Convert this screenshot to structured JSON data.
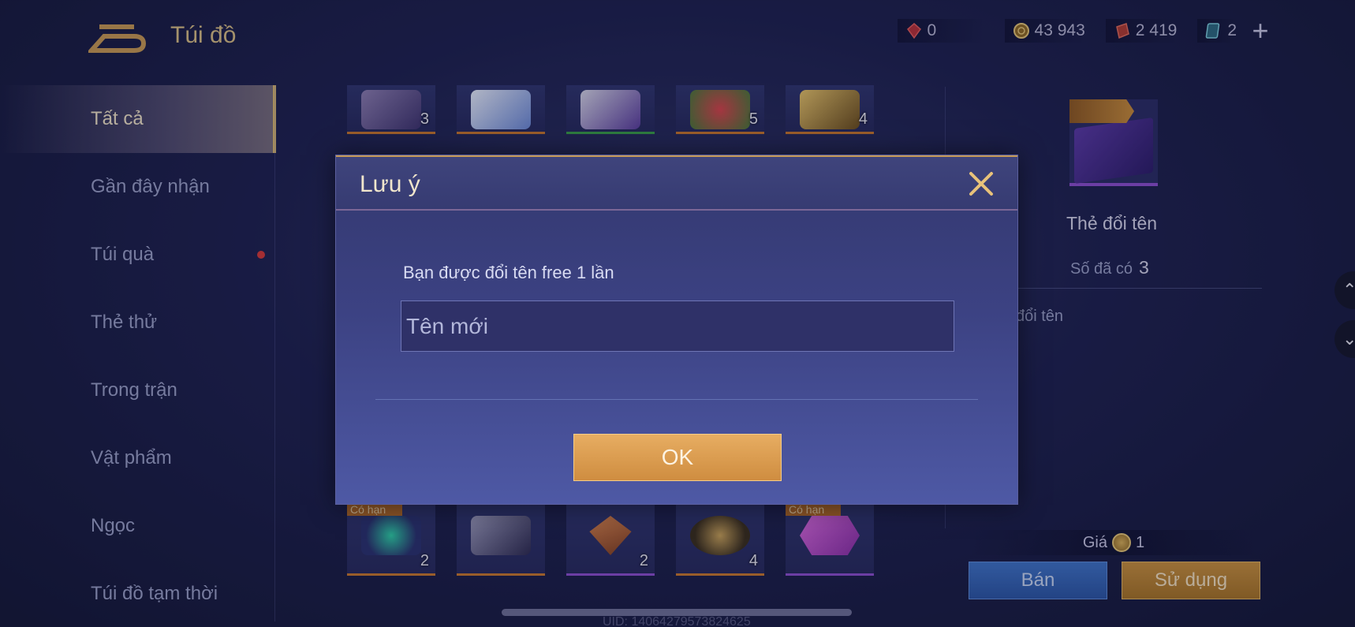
{
  "header": {
    "title": "Túi đồ",
    "currencies": [
      {
        "icon": "red-gem-icon",
        "value": "0",
        "color": "#d63a3a"
      },
      {
        "icon": "gold-coin-icon",
        "value": "43 943",
        "color": "#d9b15a"
      },
      {
        "icon": "red-voucher-icon",
        "value": "2 419",
        "color": "#c9433a"
      },
      {
        "icon": "blue-card-icon",
        "value": "2",
        "color": "#5fb2c9"
      }
    ],
    "add_label": "+"
  },
  "sidebar": {
    "items": [
      {
        "label": "Tất cả",
        "active": true
      },
      {
        "label": "Gần đây nhận"
      },
      {
        "label": "Túi quà",
        "badge": true
      },
      {
        "label": "Thẻ thử"
      },
      {
        "label": "Trong trận"
      },
      {
        "label": "Vật phẩm"
      },
      {
        "label": "Ngọc"
      },
      {
        "label": "Túi đồ tạm thời"
      }
    ]
  },
  "inventory": {
    "row_top": [
      {
        "qty": "3",
        "rarity": "orange"
      },
      {
        "qty": "",
        "rarity": "orange"
      },
      {
        "qty": "",
        "rarity": "green"
      },
      {
        "qty": "5",
        "rarity": "orange"
      },
      {
        "qty": "4",
        "rarity": "orange"
      }
    ],
    "row_bottom": [
      {
        "qty": "2",
        "rarity": "orange",
        "tag": "Có hạn"
      },
      {
        "qty": "",
        "rarity": "orange",
        "tag": ""
      },
      {
        "qty": "2",
        "rarity": "purple",
        "tag": ""
      },
      {
        "qty": "4",
        "rarity": "orange",
        "tag": ""
      },
      {
        "qty": "",
        "rarity": "purple",
        "tag": "Có hạn"
      }
    ]
  },
  "detail": {
    "name": "Thẻ đổi tên",
    "owned_label": "Số đã có",
    "owned_value": "3",
    "description": "đổi tên",
    "price_label": "Giá",
    "price_value": "1",
    "sell_label": "Bán",
    "use_label": "Sử dụng"
  },
  "footer": {
    "uid": "UID: 14064279573824625"
  },
  "modal": {
    "title": "Lưu ý",
    "message": "Bạn được đổi tên free 1 lần",
    "input_placeholder": "Tên mới",
    "input_value": "",
    "ok_label": "OK"
  }
}
